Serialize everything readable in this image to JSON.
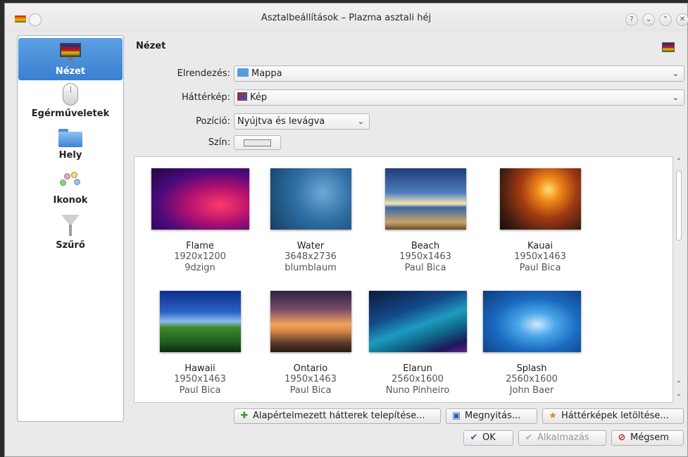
{
  "window": {
    "title": "Asztalbeállítások – Plazma asztali héj"
  },
  "titlebar_buttons": [
    "?",
    "⌄",
    "⌃",
    "✕"
  ],
  "sidebar": {
    "items": [
      {
        "label": "Nézet",
        "icon": "desktop-icon",
        "selected": true
      },
      {
        "label": "Egérműveletek",
        "icon": "mouse-icon"
      },
      {
        "label": "Hely",
        "icon": "folder-icon"
      },
      {
        "label": "Ikonok",
        "icon": "palette-icon"
      },
      {
        "label": "Szűrő",
        "icon": "filter-icon"
      }
    ]
  },
  "main": {
    "section_title": "Nézet",
    "layout": {
      "label": "Elrendezés:",
      "value": "Mappa"
    },
    "wallpaper": {
      "label": "Háttérkép:",
      "value": "Kép"
    },
    "position": {
      "label": "Pozíció:",
      "value": "Nyújtva és levágva"
    },
    "color": {
      "label": "Szín:",
      "value": "#e9e9e9"
    }
  },
  "wallpapers": [
    {
      "name": "Flame",
      "dim": "1920x1200",
      "author": "9dzign"
    },
    {
      "name": "Water",
      "dim": "3648x2736",
      "author": "blumblaum"
    },
    {
      "name": "Beach",
      "dim": "1950x1463",
      "author": "Paul Bica"
    },
    {
      "name": "Kauai",
      "dim": "1950x1463",
      "author": "Paul Bica"
    },
    {
      "name": "Hawaii",
      "dim": "1950x1463",
      "author": "Paul Bica"
    },
    {
      "name": "Ontario",
      "dim": "1950x1463",
      "author": "Paul Bica"
    },
    {
      "name": "Elarun",
      "dim": "2560x1600",
      "author": "Nuno Pinheiro"
    },
    {
      "name": "Splash",
      "dim": "2560x1600",
      "author": "John Baer"
    }
  ],
  "buttons": {
    "install_default": "Alapértelmezett hátterek telepítése...",
    "open": "Megnyitás...",
    "download": "Háttérképek letöltése...",
    "ok": "OK",
    "apply": "Alkalmazás",
    "cancel": "Mégsem"
  }
}
